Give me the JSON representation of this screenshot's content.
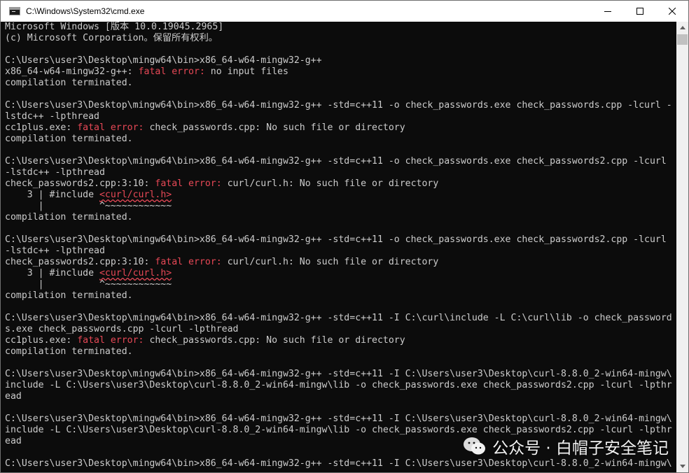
{
  "window": {
    "title": "C:\\Windows\\System32\\cmd.exe",
    "icon": "console-icon",
    "controls": [
      "minimize-icon",
      "maximize-icon",
      "close-icon"
    ]
  },
  "colors": {
    "console_bg": "#0c0c0c",
    "console_fg": "#cccccc",
    "error": "#e74856"
  },
  "console": {
    "lines": [
      [
        {
          "t": "Microsoft Windows [版本 10.0.19045.2965]"
        }
      ],
      [
        {
          "t": "(c) Microsoft Corporation。保留所有权利。"
        }
      ],
      [
        {
          "t": ""
        }
      ],
      [
        {
          "t": "C:\\Users\\user3\\Desktop\\mingw64\\bin>x86_64-w64-mingw32-g++"
        }
      ],
      [
        {
          "t": "x86_64-w64-mingw32-g++: "
        },
        {
          "t": "fatal error:",
          "c": "red"
        },
        {
          "t": " no input files"
        }
      ],
      [
        {
          "t": "compilation terminated."
        }
      ],
      [
        {
          "t": ""
        }
      ],
      [
        {
          "t": "C:\\Users\\user3\\Desktop\\mingw64\\bin>x86_64-w64-mingw32-g++ -std=c++11 -o check_passwords.exe check_passwords.cpp -lcurl -"
        }
      ],
      [
        {
          "t": "lstdc++ -lpthread"
        }
      ],
      [
        {
          "t": "cc1plus.exe: "
        },
        {
          "t": "fatal error:",
          "c": "red"
        },
        {
          "t": " check_passwords.cpp: No such file or directory"
        }
      ],
      [
        {
          "t": "compilation terminated."
        }
      ],
      [
        {
          "t": ""
        }
      ],
      [
        {
          "t": "C:\\Users\\user3\\Desktop\\mingw64\\bin>x86_64-w64-mingw32-g++ -std=c++11 -o check_passwords.exe check_passwords2.cpp -lcurl"
        }
      ],
      [
        {
          "t": "-lstdc++ -lpthread"
        }
      ],
      [
        {
          "t": "check_passwords2.cpp:3:10: "
        },
        {
          "t": "fatal error:",
          "c": "red"
        },
        {
          "t": " curl/curl.h: No such file or directory"
        }
      ],
      [
        {
          "t": "    3 | #include "
        },
        {
          "t": "<curl/curl.h>",
          "c": "red squiggle"
        }
      ],
      [
        {
          "t": "      |          ^~~~~~~~~~~~~"
        }
      ],
      [
        {
          "t": "compilation terminated."
        }
      ],
      [
        {
          "t": ""
        }
      ],
      [
        {
          "t": "C:\\Users\\user3\\Desktop\\mingw64\\bin>x86_64-w64-mingw32-g++ -std=c++11 -o check_passwords.exe check_passwords2.cpp -lcurl"
        }
      ],
      [
        {
          "t": "-lstdc++ -lpthread"
        }
      ],
      [
        {
          "t": "check_passwords2.cpp:3:10: "
        },
        {
          "t": "fatal error:",
          "c": "red"
        },
        {
          "t": " curl/curl.h: No such file or directory"
        }
      ],
      [
        {
          "t": "    3 | #include "
        },
        {
          "t": "<curl/curl.h>",
          "c": "red squiggle"
        }
      ],
      [
        {
          "t": "      |          ^~~~~~~~~~~~~"
        }
      ],
      [
        {
          "t": "compilation terminated."
        }
      ],
      [
        {
          "t": ""
        }
      ],
      [
        {
          "t": "C:\\Users\\user3\\Desktop\\mingw64\\bin>x86_64-w64-mingw32-g++ -std=c++11 -I C:\\curl\\include -L C:\\curl\\lib -o check_password"
        }
      ],
      [
        {
          "t": "s.exe check_passwords.cpp -lcurl -lpthread"
        }
      ],
      [
        {
          "t": "cc1plus.exe: "
        },
        {
          "t": "fatal error:",
          "c": "red"
        },
        {
          "t": " check_passwords.cpp: No such file or directory"
        }
      ],
      [
        {
          "t": "compilation terminated."
        }
      ],
      [
        {
          "t": ""
        }
      ],
      [
        {
          "t": "C:\\Users\\user3\\Desktop\\mingw64\\bin>x86_64-w64-mingw32-g++ -std=c++11 -I C:\\Users\\user3\\Desktop\\curl-8.8.0_2-win64-mingw\\"
        }
      ],
      [
        {
          "t": "include -L C:\\Users\\user3\\Desktop\\curl-8.8.0_2-win64-mingw\\lib -o check_passwords.exe check_passwords2.cpp -lcurl -lpthr"
        }
      ],
      [
        {
          "t": "ead"
        }
      ],
      [
        {
          "t": ""
        }
      ],
      [
        {
          "t": "C:\\Users\\user3\\Desktop\\mingw64\\bin>x86_64-w64-mingw32-g++ -std=c++11 -I C:\\Users\\user3\\Desktop\\curl-8.8.0_2-win64-mingw\\"
        }
      ],
      [
        {
          "t": "include -L C:\\Users\\user3\\Desktop\\curl-8.8.0_2-win64-mingw\\lib -o check_passwords.exe check_passwords2.cpp -lcurl -lpthr"
        }
      ],
      [
        {
          "t": "ead"
        }
      ],
      [
        {
          "t": ""
        }
      ],
      [
        {
          "t": "C:\\Users\\user3\\Desktop\\mingw64\\bin>x86_64-w64-mingw32-g++ -std=c++11 -I C:\\Users\\user3\\Desktop\\curl-8.8.0_2-win64-mingw\\"
        }
      ]
    ]
  },
  "watermark": {
    "text": "公众号 · 白帽子安全笔记",
    "icon": "wechat-icon"
  }
}
